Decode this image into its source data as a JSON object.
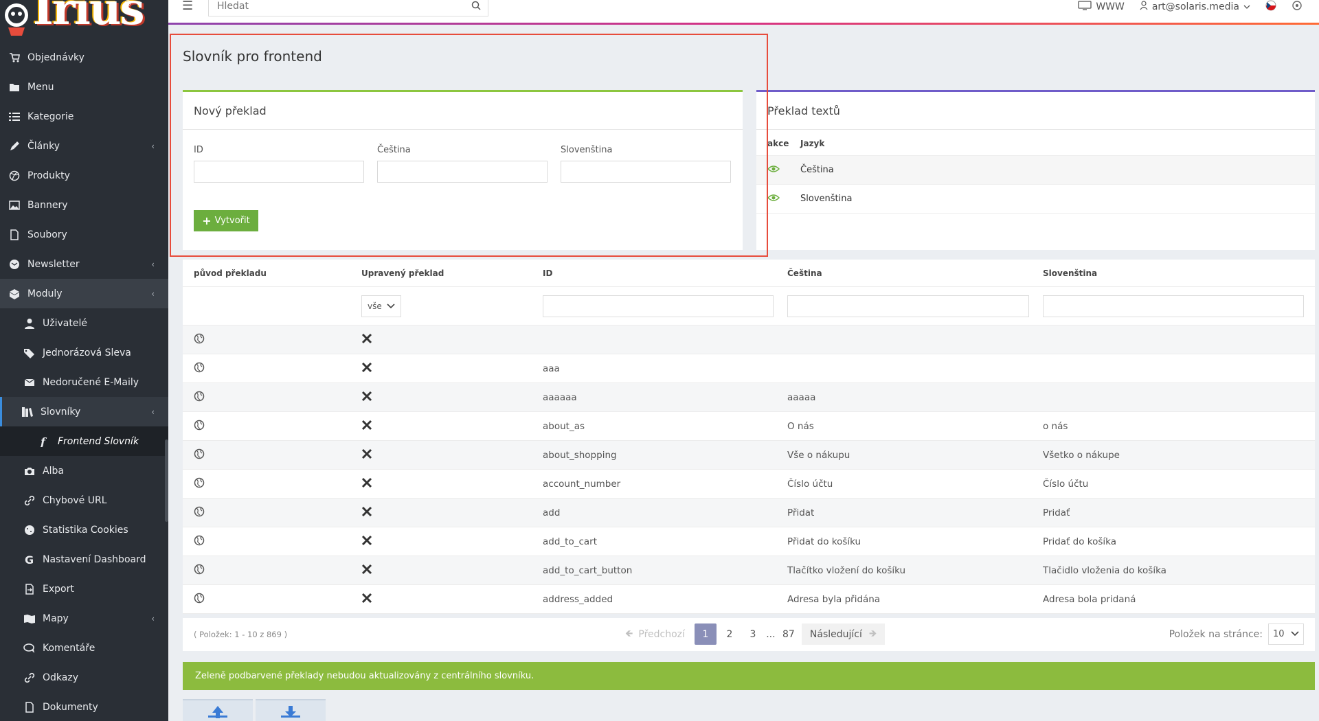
{
  "brand": {
    "logo_text": "Irius",
    "logo_reg": "®"
  },
  "topbar": {
    "search_placeholder": "Hledat",
    "www_label": "WWW",
    "user_email": "art@solaris.media"
  },
  "sidebar": {
    "items": [
      {
        "label": "Objednávky",
        "icon": "cart-icon"
      },
      {
        "label": "Menu",
        "icon": "folder-icon"
      },
      {
        "label": "Kategorie",
        "icon": "list-icon"
      },
      {
        "label": "Články",
        "icon": "pencil-icon",
        "arrow": "‹"
      },
      {
        "label": "Produkty",
        "icon": "dribbble-icon"
      },
      {
        "label": "Bannery",
        "icon": "image-icon"
      },
      {
        "label": "Soubory",
        "icon": "file-icon"
      },
      {
        "label": "Newsletter",
        "icon": "envelope-icon",
        "arrow": "‹"
      },
      {
        "label": "Moduly",
        "icon": "cubes-icon",
        "arrow": "‹"
      }
    ],
    "module_items": [
      {
        "label": "Uživatelé",
        "icon": "user-icon"
      },
      {
        "label": "Jednorázová Sleva",
        "icon": "tags-icon"
      },
      {
        "label": "Nedoručené E-Maily",
        "icon": "mail-icon"
      },
      {
        "label": "Slovníky",
        "icon": "books-icon",
        "arrow": "‹"
      }
    ],
    "current_item": {
      "label": "Frontend Slovník",
      "icon": "font-icon"
    },
    "more_items": [
      {
        "label": "Alba",
        "icon": "camera-icon"
      },
      {
        "label": "Chybové URL",
        "icon": "link-icon"
      },
      {
        "label": "Statistika Cookies",
        "icon": "cookie-icon"
      },
      {
        "label": "Nastavení Dashboard",
        "icon": "google-icon"
      },
      {
        "label": "Export",
        "icon": "export-icon"
      },
      {
        "label": "Mapy",
        "icon": "map-icon",
        "arrow": "‹"
      },
      {
        "label": "Komentáře",
        "icon": "comments-icon"
      },
      {
        "label": "Odkazy",
        "icon": "link-icon"
      },
      {
        "label": "Dokumenty",
        "icon": "document-icon"
      }
    ]
  },
  "page": {
    "title": "Slovník pro frontend"
  },
  "new_translation": {
    "title": "Nový překlad",
    "fields": [
      {
        "label": "ID",
        "value": ""
      },
      {
        "label": "Čeština",
        "value": ""
      },
      {
        "label": "Slovenština",
        "value": ""
      }
    ],
    "create_label": "Vytvořit"
  },
  "lang_panel": {
    "title": "Překlad textů",
    "col_akce": "akce",
    "col_jazyk": "Jazyk",
    "rows": [
      "Čeština",
      "Slovenština"
    ]
  },
  "table": {
    "headers": [
      "původ překladu",
      "Upravený překlad",
      "ID",
      "Čeština",
      "Slovenština"
    ],
    "filter_select": "vše",
    "rows": [
      {
        "id": "",
        "cs": "",
        "sk": ""
      },
      {
        "id": "aaa",
        "cs": "",
        "sk": ""
      },
      {
        "id": "aaaaaa",
        "cs": "aaaaa",
        "sk": ""
      },
      {
        "id": "about_as",
        "cs": "O nás",
        "sk": "o nás"
      },
      {
        "id": "about_shopping",
        "cs": "Vše o nákupu",
        "sk": "Všetko o nákupe"
      },
      {
        "id": "account_number",
        "cs": "Číslo účtu",
        "sk": "Číslo účtu"
      },
      {
        "id": "add",
        "cs": "Přidat",
        "sk": "Pridať"
      },
      {
        "id": "add_to_cart",
        "cs": "Přidat do košíku",
        "sk": "Pridať do košíka"
      },
      {
        "id": "add_to_cart_button",
        "cs": "Tlačítko vložení do košíku",
        "sk": "Tlačidlo vloženia do košíka"
      },
      {
        "id": "address_added",
        "cs": "Adresa byla přidána",
        "sk": "Adresa bola pridaná"
      }
    ]
  },
  "pager": {
    "count": "( Položek: 1 - 10 z 869 )",
    "prev": "Předchozí",
    "pages": [
      "1",
      "2",
      "3"
    ],
    "ellipsis": "...",
    "last": "87",
    "next": "Následující",
    "per_page_label": "Položek na stránce:",
    "per_page_value": "10"
  },
  "notice": "Zeleně podbarvené překlady nebudou aktualizovány z centrálního slovníku."
}
